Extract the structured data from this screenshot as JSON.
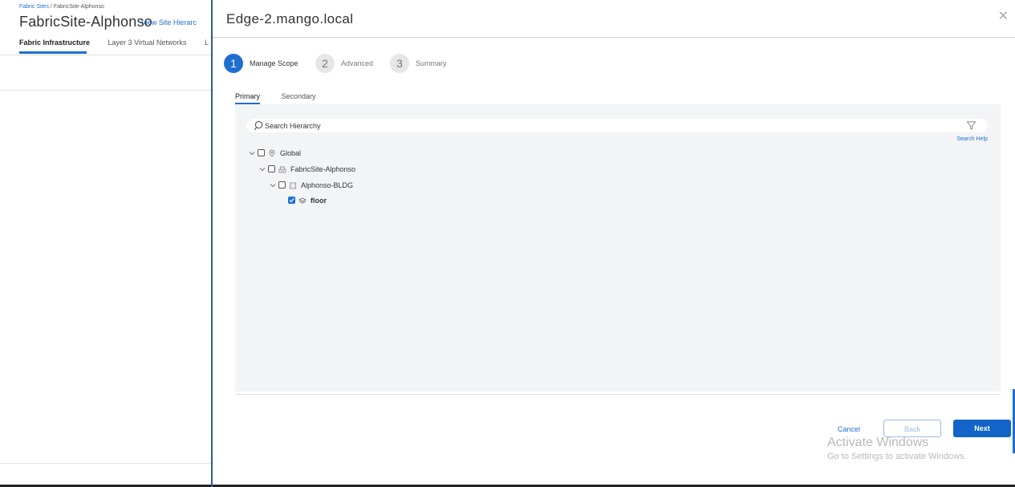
{
  "background_page": {
    "breadcrumb": {
      "link": "Fabric Sites",
      "separator": " / ",
      "current": "FabricSite-Alphonso"
    },
    "title": "FabricSite-Alphonso",
    "view_hierarchy_link": "View Site Hierarc",
    "tabs": [
      "Fabric Infrastructure",
      "Layer 3 Virtual Networks",
      "L"
    ]
  },
  "drawer": {
    "title": "Edge-2.mango.local",
    "close_icon": "close-icon",
    "steps": [
      {
        "number": "1",
        "label": "Manage Scope",
        "state": "active"
      },
      {
        "number": "2",
        "label": "Advanced",
        "state": "inactive"
      },
      {
        "number": "3",
        "label": "Summary",
        "state": "inactive"
      }
    ],
    "sub_tabs": {
      "primary": "Primary",
      "secondary": "Secondary",
      "active": "Primary"
    },
    "search": {
      "placeholder": "Search Hierarchy",
      "value": "",
      "help": "Search Help"
    },
    "tree": [
      {
        "label": "Global",
        "icon": "location-pin-icon",
        "checked": false,
        "expanded": true,
        "level": 0
      },
      {
        "label": "FabricSite-Alphonso",
        "icon": "area-icon",
        "checked": false,
        "expanded": true,
        "level": 1
      },
      {
        "label": "Alphonso-BLDG",
        "icon": "building-icon",
        "checked": false,
        "expanded": true,
        "level": 2
      },
      {
        "label": "floor",
        "icon": "floor-icon",
        "checked": true,
        "expanded": false,
        "level": 3
      }
    ],
    "footer": {
      "cancel": "Cancel",
      "back": "Back",
      "next": "Next"
    }
  },
  "watermark": {
    "title": "Activate Windows",
    "subtitle": "Go to Settings to activate Windows."
  },
  "colors": {
    "accent": "#1e6fd0",
    "primary_button": "#1264c9",
    "panel_bg": "#f3f4f6"
  }
}
